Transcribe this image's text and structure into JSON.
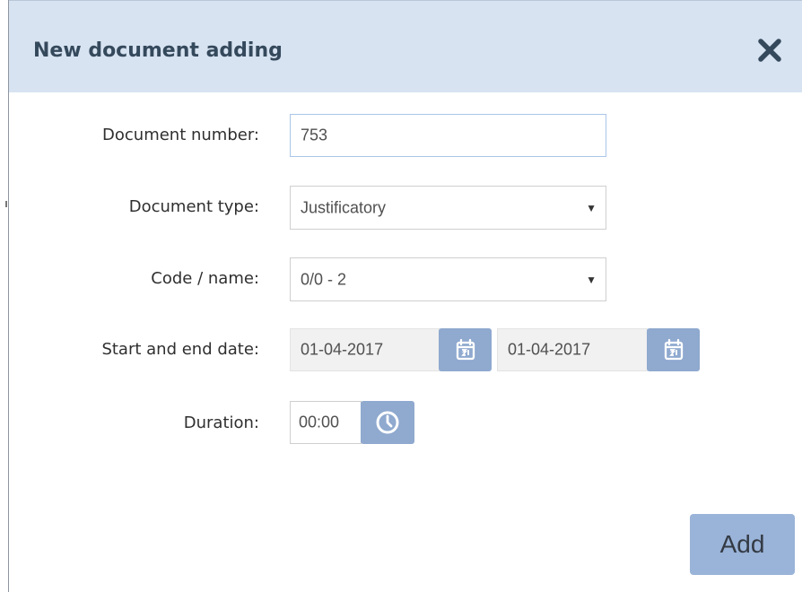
{
  "dialog": {
    "title": "New document adding",
    "close_icon": "close-icon",
    "add_label": "Add"
  },
  "form": {
    "document_number": {
      "label": "Document number:",
      "value": "753"
    },
    "document_type": {
      "label": "Document type:",
      "selected": "Justificatory",
      "arrow": "▼"
    },
    "code_name": {
      "label": "Code / name:",
      "selected": "0/0 - 2",
      "arrow": "▼"
    },
    "dates": {
      "label": "Start and end date:",
      "start": "01-04-2017",
      "end": "01-04-2017",
      "start_icon": "calendar-icon",
      "end_icon": "calendar-icon"
    },
    "duration": {
      "label": "Duration:",
      "value": "00:00",
      "icon": "clock-icon"
    }
  },
  "colors": {
    "header_background": "#d7e3f1",
    "title_text": "#35495c",
    "accent_button": "#8fa9cf",
    "add_button": "#9ab3d8"
  }
}
